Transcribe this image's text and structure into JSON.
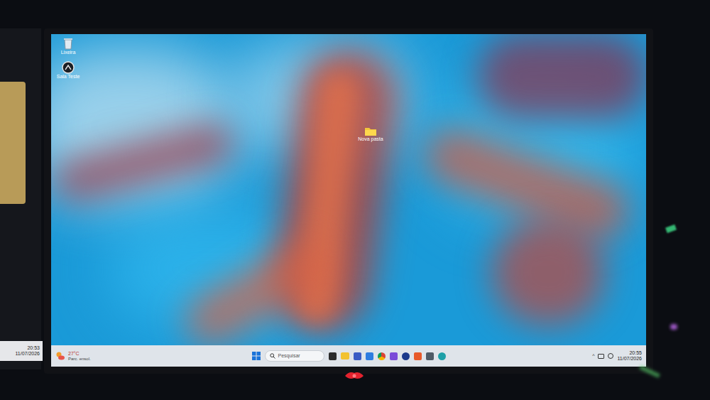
{
  "desktop": {
    "icons": [
      {
        "label": "Lixeira"
      },
      {
        "label": "Sala Teste"
      }
    ],
    "folder": {
      "label": "Nova pasta"
    }
  },
  "taskbar": {
    "weather": {
      "temp": "27°C",
      "condition": "Parc. ensol."
    },
    "search": {
      "placeholder": "Pesquisar"
    },
    "tray": {
      "time": "20:55",
      "date": "11/07/2026"
    }
  },
  "side_screen": {
    "time": "20:53",
    "date": "11/07/2026"
  }
}
